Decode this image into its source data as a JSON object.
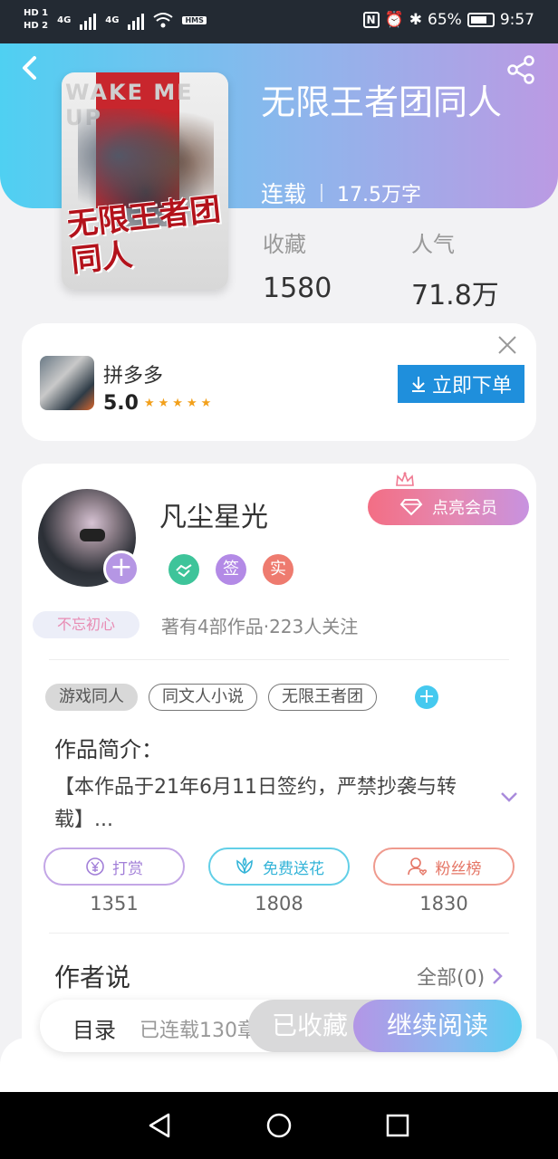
{
  "status_bar": {
    "hd1": "HD 1",
    "hd2": "HD 2",
    "net1": "4G",
    "net2": "4G",
    "hms": "HMS",
    "battery": "65%",
    "time": "9:57"
  },
  "book": {
    "title": "无限王者团同人",
    "status": "连载",
    "words": "17.5万字",
    "cover_wake_text": "WAKE ME UP",
    "cover_title": "无限王者团同人",
    "stats": [
      {
        "label": "收藏",
        "value": "1580"
      },
      {
        "label": "人气",
        "value": "71.8万"
      }
    ]
  },
  "ad": {
    "name": "拼多多",
    "rating": "5.0",
    "stars": "★★★★★",
    "button": "立即下单"
  },
  "author": {
    "name": "凡尘星光",
    "vip_button": "点亮会员",
    "badges": [
      "签",
      "实"
    ],
    "motto": "不忘初心",
    "works_info": "著有4部作品·223人关注"
  },
  "tags": [
    "游戏同人",
    "同文人小说",
    "无限王者团"
  ],
  "intro": {
    "label": "作品简介：",
    "text": "【本作品于21年6月11日签约，严禁抄袭与转载】..."
  },
  "actions": [
    {
      "label": "打赏",
      "count": "1351"
    },
    {
      "label": "免费送花",
      "count": "1808"
    },
    {
      "label": "粉丝榜",
      "count": "1830"
    }
  ],
  "author_say": {
    "label": "作者说",
    "all": "全部(0)"
  },
  "bottom": {
    "toc": "目录",
    "progress": "已连载130章",
    "collected": "已收藏",
    "read": "继续阅读"
  },
  "colors": {
    "header_start": "#4fd0f2",
    "header_end": "#bb9ae3",
    "ad_button": "#1f8fdc",
    "star": "#f2a01b"
  }
}
